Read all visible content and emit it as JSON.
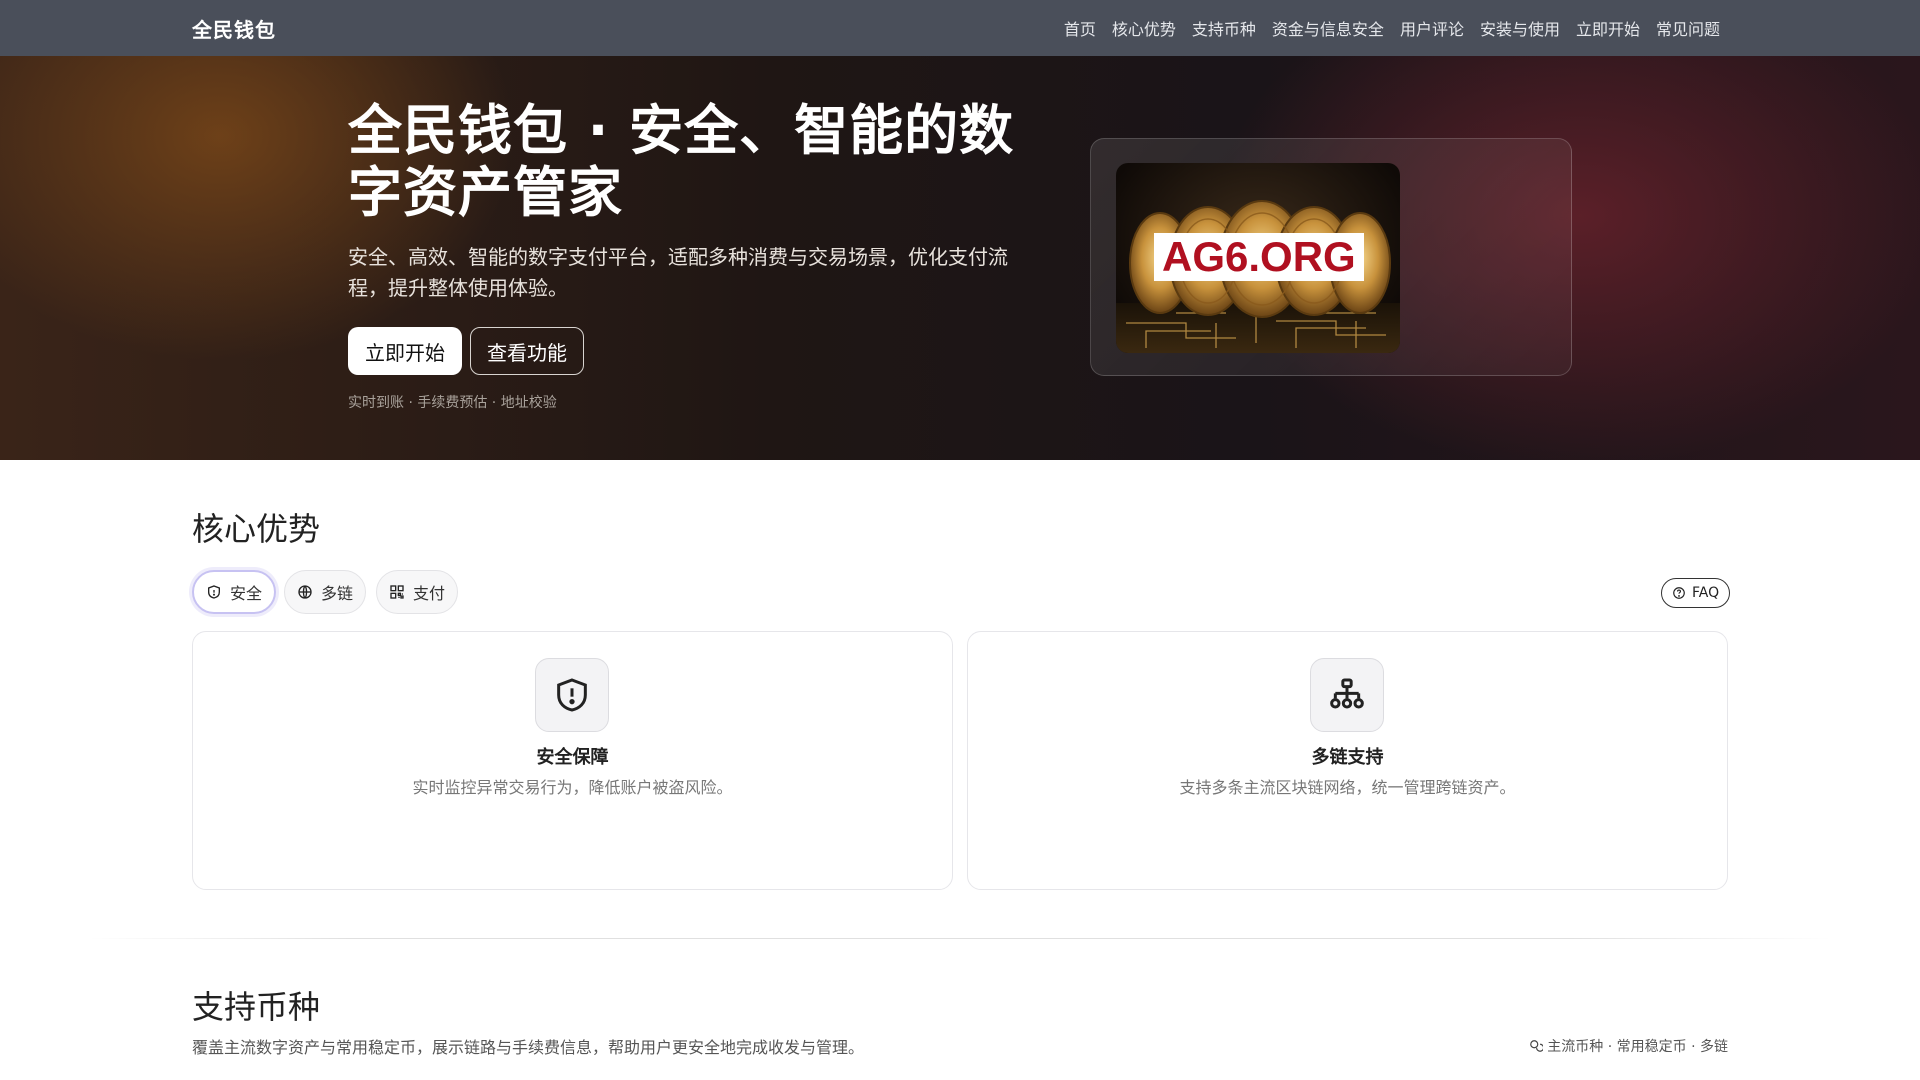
{
  "nav": {
    "brand": "全民钱包",
    "links": [
      "首页",
      "核心优势",
      "支持币种",
      "资金与信息安全",
      "用户评论",
      "安装与使用",
      "立即开始",
      "常见问题"
    ]
  },
  "hero": {
    "title": "全民钱包 · 安全、智能的数字资产管家",
    "subtitle": "安全、高效、智能的数字支付平台，适配多种消费与交易场景，优化支付流程，提升整体使用体验。",
    "primary_button": "立即开始",
    "secondary_button": "查看功能",
    "tags": "实时到账 · 手续费预估 · 地址校验",
    "image_label": "AG6.ORG"
  },
  "advantages": {
    "title": "核心优势",
    "chips": [
      {
        "label": "安全",
        "icon": "shield-icon"
      },
      {
        "label": "多链",
        "icon": "globe-icon"
      },
      {
        "label": "支付",
        "icon": "qr-code-icon"
      }
    ],
    "faq_label": "FAQ",
    "cards": [
      {
        "title": "安全保障",
        "desc": "实时监控异常交易行为，降低账户被盗风险。",
        "icon": "shield-alert-icon"
      },
      {
        "title": "多链支持",
        "desc": "支持多条主流区块链网络，统一管理跨链资产。",
        "icon": "network-icon"
      }
    ]
  },
  "currencies": {
    "title": "支持币种",
    "desc": "覆盖主流数字资产与常用稳定币，展示链路与手续费信息，帮助用户更安全地完成收发与管理。",
    "meta": "主流币种 · 常用稳定币 · 多链"
  },
  "colors": {
    "nav_bg": "#4a4f5a",
    "accent_chip_border": "#c7c2f2",
    "image_label_text": "#b01020"
  }
}
